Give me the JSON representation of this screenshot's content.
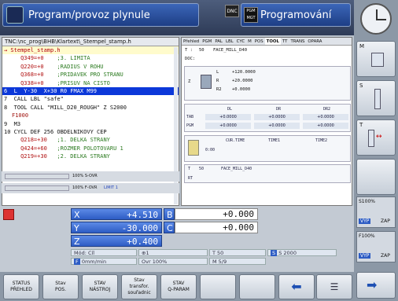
{
  "header": {
    "left_mode": "Program/provoz plynule",
    "right_mode": "Programování",
    "dnc": "DNC",
    "pgm_badge_line1": "PGM",
    "pgm_badge_line2": "MGT"
  },
  "program": {
    "path": "TNC:\\nc_prog\\BHB\\Klartext\\_Stempel_stamp.h",
    "title": "→ Stempel_stamp.h",
    "lines": [
      {
        "num": "Q349=+0",
        "com": ";3. LIMITA"
      },
      {
        "num": "Q220=+0",
        "com": ";RADIUS V ROHU"
      },
      {
        "num": "Q368=+0",
        "com": ";PRIDAVEK PRO STRANU"
      },
      {
        "num": "Q338=+0",
        "com": ";PRISUV NA CISTO"
      }
    ],
    "active_line": "6  L  Y-30  X+30 R0 FMAX M99",
    "line7": "7  CALL LBL \"safe\"",
    "line8": "8  TOOL CALL \"MILL_D20_ROUGH\" Z S2000",
    "line8b": "F1000",
    "line9": "9  M3",
    "line10": "10 CYCL DEF 256 OBDELNIKOVY CEP",
    "cycle_lines": [
      {
        "num": "Q218=+30",
        "com": ";1. DELKA STRANY"
      },
      {
        "num": "Q424=+60",
        "com": ";ROZMER POLOTOVARU 1"
      },
      {
        "num": "Q219=+30",
        "com": ";2. DELKA STRANY"
      }
    ]
  },
  "overrides": {
    "s_ovr": "100% S-OVR",
    "f_ovr": "100% F-OVR",
    "limit": "LIMIT 1"
  },
  "status": {
    "tabs": [
      "Přehled",
      "PGM",
      "PAL",
      "LBL",
      "CYC",
      "M",
      "POS",
      "TOOL",
      "TT",
      "TRANS",
      "OPARA"
    ],
    "active_tab": "TOOL",
    "t_label": "T :",
    "t_num": "50",
    "t_name": "FACE_MILL_D40",
    "doc_label": "DOC:",
    "L_label": "L",
    "L_val": "+120.0000",
    "R_label": "R",
    "R_val": "+20.0000",
    "R2_label": "R2",
    "R2_val": "+0.0000",
    "axis_label": "Z",
    "h_dl": "DL",
    "h_dr": "DR",
    "h_dr2": "DR2",
    "row_tab": "TAB",
    "row_pgm": "PGM",
    "tab_dl": "+0.0000",
    "tab_dr": "+0.0000",
    "tab_dr2": "+0.0000",
    "pgm_dl": "+0.0000",
    "pgm_dr": "+0.0000",
    "pgm_dr2": "+0.0000",
    "h_cur": "CUR.TIME",
    "h_t1": "TIME1",
    "h_t2": "TIME2",
    "cur_time": "0:00",
    "t2_label": "T",
    "t2_num": "50",
    "t2_name": "FACE_MILL_D40",
    "rt_label": "RT"
  },
  "position": {
    "x_label": "X",
    "x_val": "+4.510",
    "b_label": "B",
    "b_val": "+0.000",
    "y_label": "Y",
    "y_val": "-30.000",
    "c_label": "C",
    "c_val": "+0.000",
    "z_label": "Z",
    "z_val": "+0.400",
    "mode": "Mód: Cíl",
    "preset": "1",
    "tool": "T 50",
    "spindle": "S 2000",
    "feed": "0mm/min",
    "ovr": "Ovr 100%",
    "m": "M 5/9"
  },
  "softkeys_bottom": [
    {
      "l1": "STATUS",
      "l2": "PŘEHLED"
    },
    {
      "l1": "Stav",
      "l2": "POS."
    },
    {
      "l1": "STAV",
      "l2": "NÁSTROJ"
    },
    {
      "l1": "Stav",
      "l2": "transfor.",
      "l3": "souřadnic"
    },
    {
      "l1": "STAV",
      "l2": "Q-PARAM"
    }
  ],
  "softkeys_right": {
    "m": "M",
    "s": "S",
    "t": "T",
    "s100": "S100%",
    "vyp": "VYP",
    "zap": "ZAP",
    "f100": "F100%",
    "vyp2": "VYP",
    "zap2": "ZAP"
  }
}
